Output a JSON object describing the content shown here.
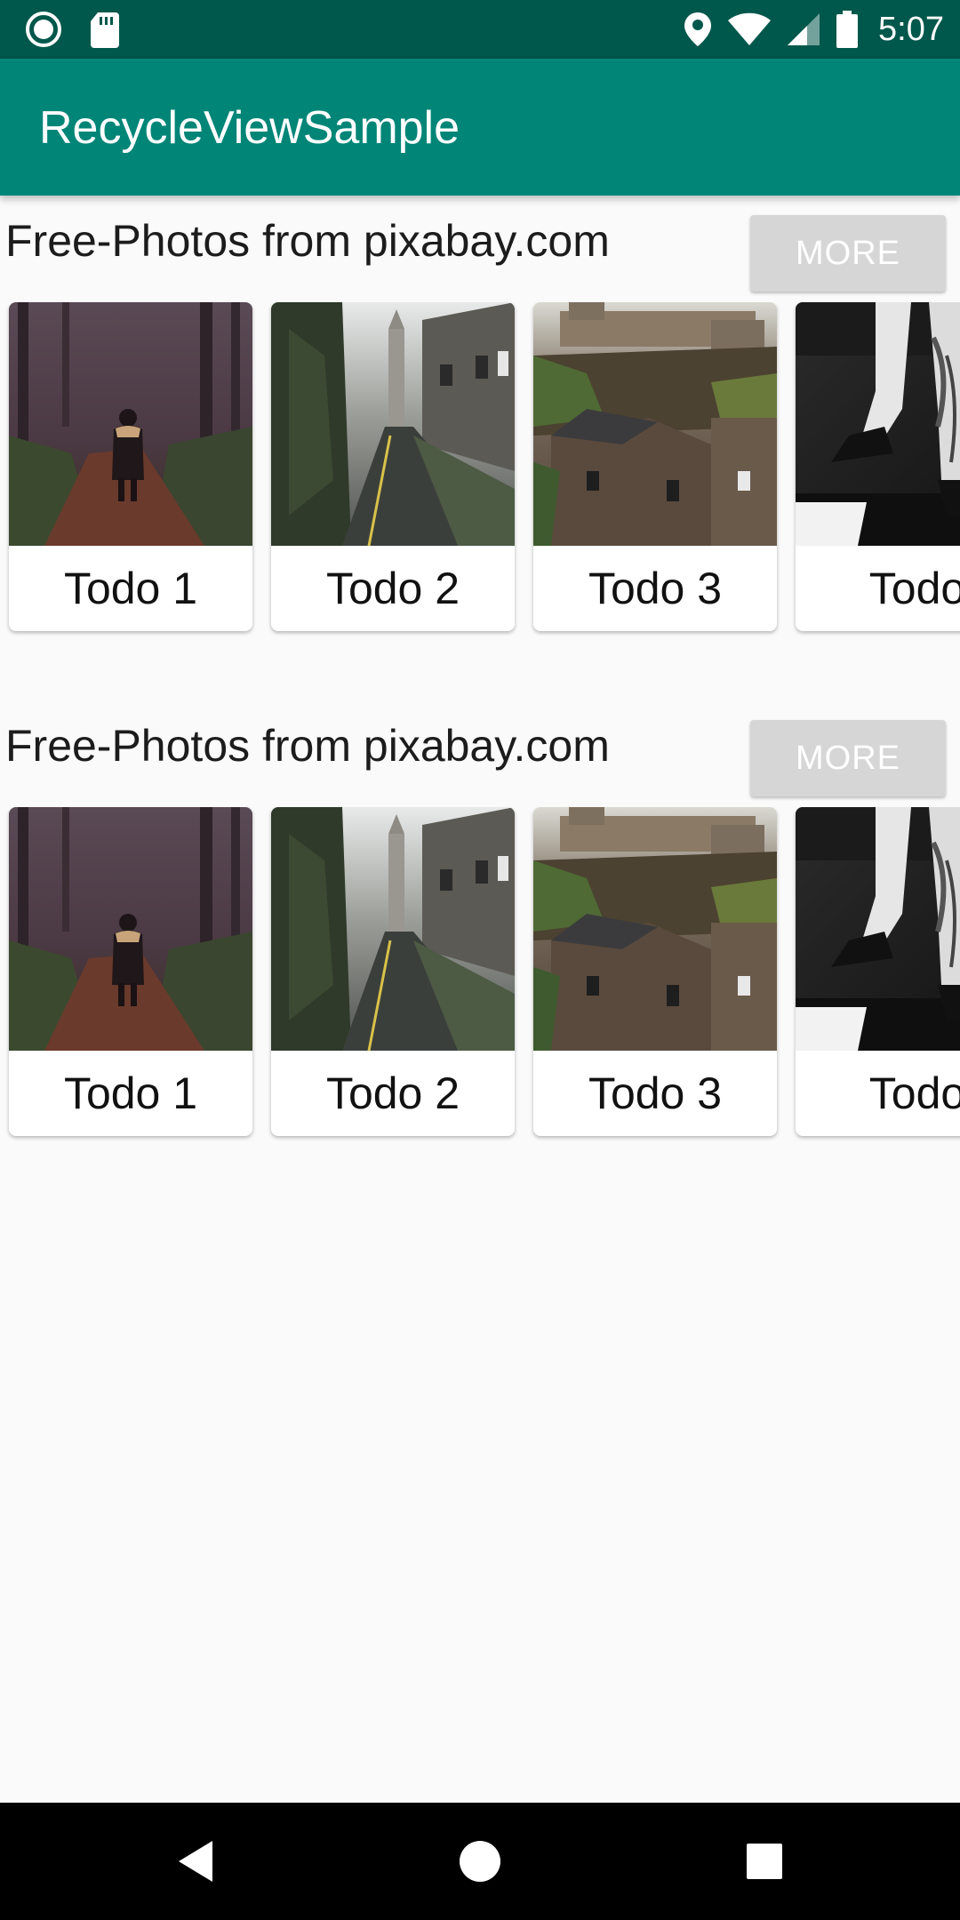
{
  "status_bar": {
    "time": "5:07",
    "icons": [
      "notification-ring-icon",
      "sd-card-icon",
      "location-icon",
      "wifi-icon",
      "signal-icon",
      "battery-icon"
    ]
  },
  "app_bar": {
    "title": "RecycleViewSample"
  },
  "sections": [
    {
      "title": "Free-Photos from pixabay.com",
      "more_label": "MORE",
      "cards": [
        {
          "label": "Todo 1",
          "image": "forest-path-child"
        },
        {
          "label": "Todo 2",
          "image": "cobblestone-street"
        },
        {
          "label": "Todo 3",
          "image": "castle-on-hill"
        },
        {
          "label": "Todo",
          "image": "tattooed-legs-bw"
        }
      ]
    },
    {
      "title": "Free-Photos from pixabay.com",
      "more_label": "MORE",
      "cards": [
        {
          "label": "Todo 1",
          "image": "forest-path-child"
        },
        {
          "label": "Todo 2",
          "image": "cobblestone-street"
        },
        {
          "label": "Todo 3",
          "image": "castle-on-hill"
        },
        {
          "label": "Todo",
          "image": "tattooed-legs-bw"
        }
      ]
    }
  ],
  "nav_bar": {
    "icons": [
      "back-icon",
      "home-icon",
      "recents-icon"
    ]
  },
  "colors": {
    "primary": "#008577",
    "primary_dark": "#00574b",
    "button_bg": "#d6d6d6"
  }
}
